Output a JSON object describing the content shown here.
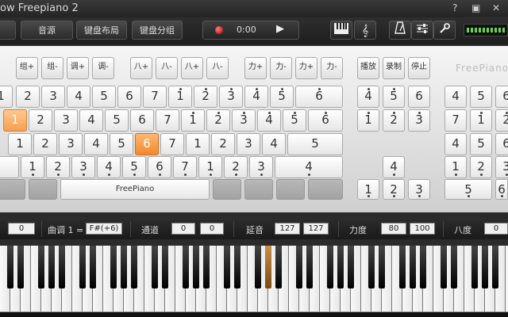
{
  "window": {
    "title": "ow Freepiano 2",
    "controls": [
      "?",
      "▣",
      "✕"
    ]
  },
  "toolbar": {
    "buttons": [
      "音源",
      "键盘布局",
      "键盘分组"
    ],
    "player": {
      "time": "0:00"
    },
    "icons": [
      "piano-keys-icon",
      "score-icon",
      "metronome-icon",
      "mixer-icon",
      "wrench-icon"
    ]
  },
  "keyboard": {
    "brand": "FreePiano",
    "ctl_row": [
      "组+",
      "组-",
      "调+",
      "调-",
      "八+",
      "八-",
      "八+",
      "八-",
      "力+",
      "力-",
      "力+",
      "力-",
      "播放",
      "录制",
      "停止"
    ],
    "row1": [
      "1",
      "2",
      "3",
      "4",
      "5",
      "6",
      "7",
      "1",
      "2",
      "3",
      "4",
      "5",
      "6"
    ],
    "row2": [
      "1",
      "2",
      "3",
      "4",
      "5",
      "6",
      "7",
      "1",
      "2",
      "3",
      "4",
      "5",
      "6"
    ],
    "row3": [
      "1",
      "2",
      "3",
      "4",
      "5",
      "6",
      "7",
      "1",
      "2",
      "3",
      "4",
      "5"
    ],
    "row4": [
      "1",
      "2",
      "3",
      "4",
      "5",
      "6",
      "7",
      "1",
      "2",
      "3",
      "4"
    ],
    "space_label": "FreePiano",
    "keypad": {
      "r1": [
        "4",
        "5",
        "6"
      ],
      "r2": [
        "1",
        "2",
        "3"
      ],
      "r4": [
        "4"
      ],
      "r5": [
        "1",
        "2",
        "3"
      ]
    },
    "numpad": {
      "r1": [
        "4",
        "5",
        "6"
      ],
      "r2": [
        "7",
        "1",
        "2"
      ],
      "r3": [
        "4",
        "5",
        "6"
      ],
      "r4": [
        "1",
        "2",
        "3"
      ],
      "r5": [
        "5",
        "6"
      ]
    }
  },
  "status": {
    "first_value": "0",
    "key_label": "曲调 1 =",
    "key_value": "F#(+6)",
    "channel_label": "通道",
    "channel_values": [
      "0",
      "0"
    ],
    "sustain_label": "延音",
    "sustain_values": [
      "127",
      "127"
    ],
    "velocity_label": "力度",
    "velocity_values": [
      "80",
      "100"
    ],
    "octave_label": "八度",
    "octave_value": "0"
  }
}
